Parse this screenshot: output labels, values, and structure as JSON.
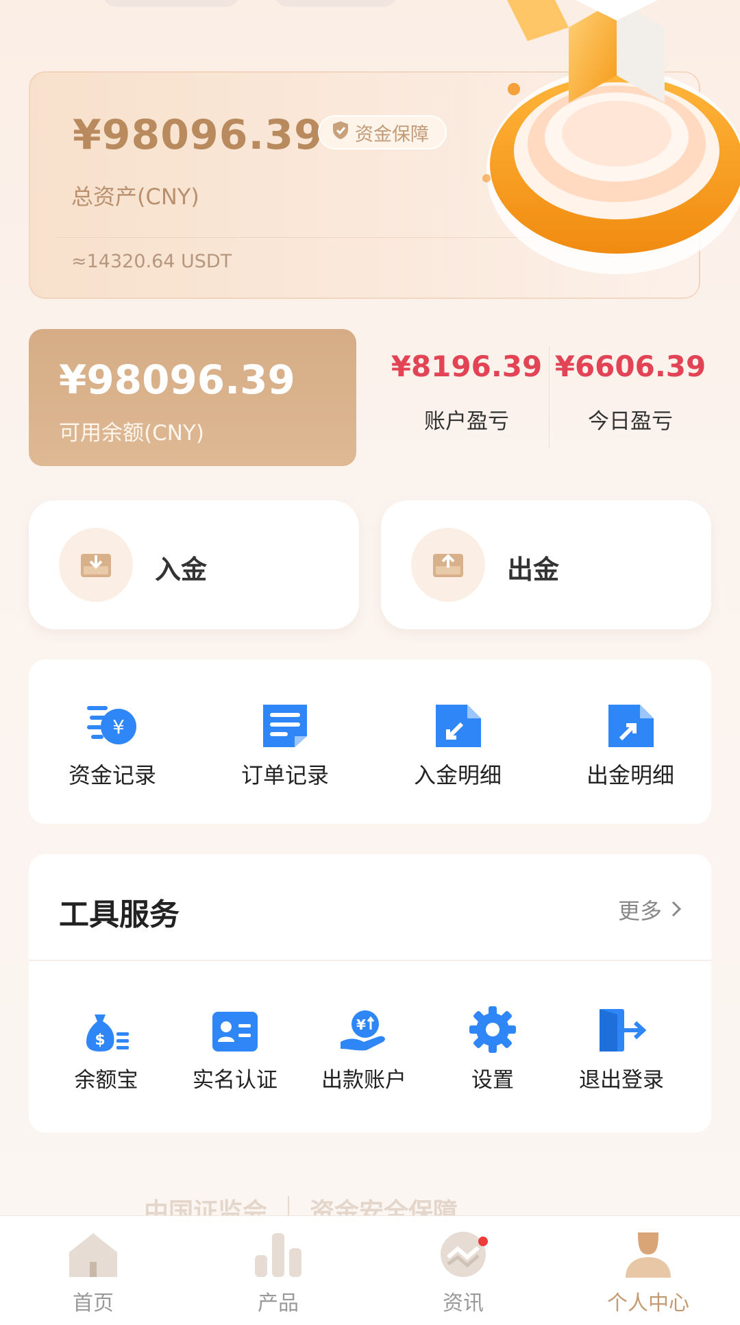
{
  "asset": {
    "total": "¥98096.39",
    "badge": "资金保障",
    "label": "总资产(CNY)",
    "usdt": "≈14320.64 USDT"
  },
  "balance": {
    "amount": "¥98096.39",
    "label": "可用余额(CNY)"
  },
  "pnl": {
    "account_value": "¥8196.39",
    "account_label": "账户盈亏",
    "today_value": "¥6606.39",
    "today_label": "今日盈亏"
  },
  "actions": {
    "deposit": "入金",
    "withdraw": "出金"
  },
  "records": [
    {
      "label": "资金记录",
      "icon": "fund-record-icon"
    },
    {
      "label": "订单记录",
      "icon": "order-record-icon"
    },
    {
      "label": "入金明细",
      "icon": "deposit-detail-icon"
    },
    {
      "label": "出金明细",
      "icon": "withdraw-detail-icon"
    }
  ],
  "tools": {
    "title": "工具服务",
    "more": "更多",
    "items": [
      {
        "label": "余额宝",
        "icon": "money-bag-icon"
      },
      {
        "label": "实名认证",
        "icon": "id-card-icon"
      },
      {
        "label": "出款账户",
        "icon": "payout-account-icon"
      },
      {
        "label": "设置",
        "icon": "gear-icon"
      },
      {
        "label": "退出登录",
        "icon": "logout-icon"
      }
    ]
  },
  "footer": {
    "left": "中国证监会",
    "right": "资金安全保障"
  },
  "tabs": [
    {
      "label": "首页",
      "icon": "home-icon"
    },
    {
      "label": "产品",
      "icon": "chart-icon"
    },
    {
      "label": "资讯",
      "icon": "news-icon"
    },
    {
      "label": "个人中心",
      "icon": "user-icon"
    }
  ],
  "colors": {
    "accent": "#d5ac85",
    "profit_red": "#e24455",
    "icon_blue": "#2f86f6"
  }
}
